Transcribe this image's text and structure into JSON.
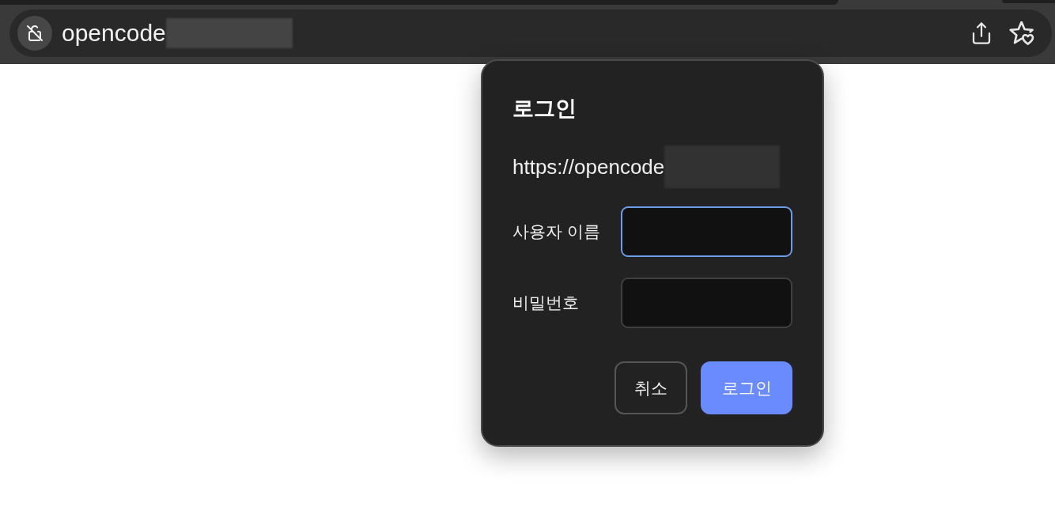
{
  "address_bar": {
    "text": "opencode"
  },
  "dialog": {
    "title": "로그인",
    "url": "https://opencode",
    "fields": [
      {
        "label": "사용자 이름",
        "focused": true
      },
      {
        "label": "비밀번호",
        "focused": false
      }
    ],
    "buttons": [
      {
        "label": "취소",
        "kind": "secondary"
      },
      {
        "label": "로그인",
        "kind": "primary"
      }
    ]
  }
}
